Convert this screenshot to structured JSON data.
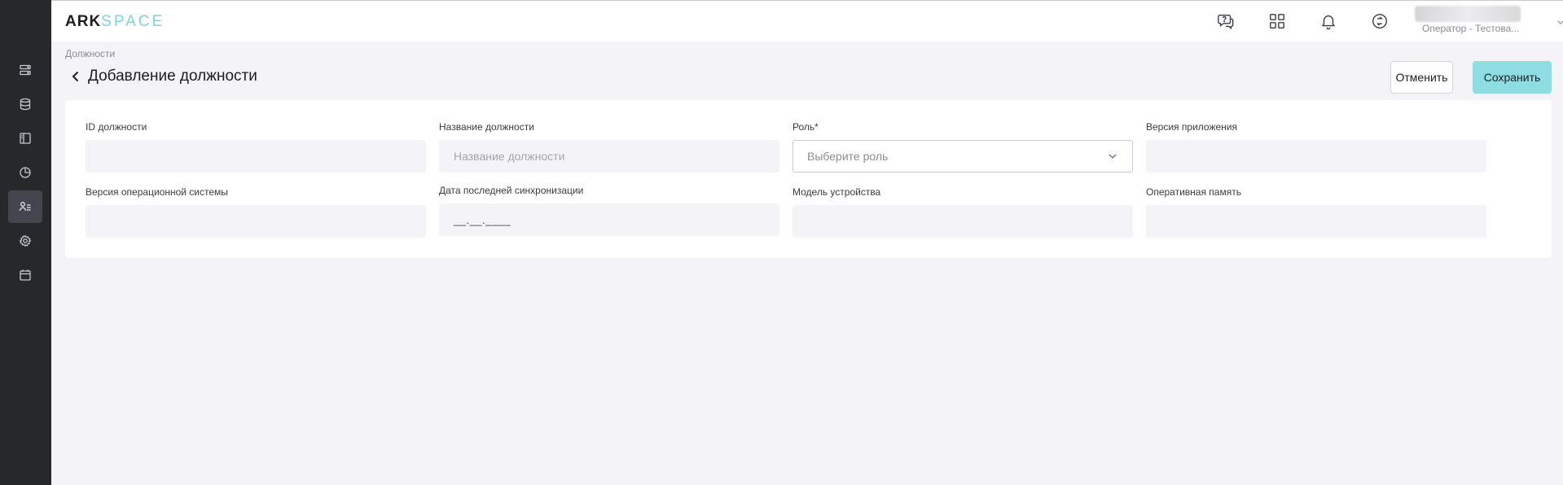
{
  "app": {
    "logo_part1": "ARK",
    "logo_part2": "SPACE"
  },
  "sidebar": {
    "items": [
      {
        "icon": "server-list-icon",
        "active": false
      },
      {
        "icon": "database-icon",
        "active": false
      },
      {
        "icon": "layout-panel-icon",
        "active": false
      },
      {
        "icon": "pie-chart-icon",
        "active": false
      },
      {
        "icon": "users-list-icon",
        "active": true
      },
      {
        "icon": "settings-gear-icon",
        "active": false
      },
      {
        "icon": "calendar-icon",
        "active": false
      }
    ]
  },
  "topbar": {
    "icons": [
      "help-chat-icon",
      "apps-grid-icon",
      "bell-icon",
      "sync-icon"
    ],
    "user_role": "Оператор - Тестова..."
  },
  "breadcrumb": "Должности",
  "page_title": "Добавление должности",
  "actions": {
    "cancel_label": "Отменить",
    "save_label": "Сохранить"
  },
  "form": {
    "fields": [
      {
        "label": "ID должности",
        "value": "",
        "placeholder": ""
      },
      {
        "label": "Название должности",
        "value": "",
        "placeholder": "Название должности"
      },
      {
        "label": "Роль*",
        "value": "",
        "placeholder": "Выберите роль"
      },
      {
        "label": "Версия приложения",
        "value": "",
        "placeholder": ""
      },
      {
        "label": "Версия операционной системы",
        "value": "",
        "placeholder": ""
      },
      {
        "label": "Дата последней синхронизации",
        "value": "__.__.____",
        "placeholder": ""
      },
      {
        "label": "Модель устройства",
        "value": "",
        "placeholder": ""
      },
      {
        "label": "Оперативная память",
        "value": "",
        "placeholder": ""
      }
    ]
  },
  "colors": {
    "sidebar_bg": "#27282c",
    "accent": "#8ddde2",
    "logo_accent": "#7fd3dc",
    "page_bg": "#f4f4f8"
  }
}
